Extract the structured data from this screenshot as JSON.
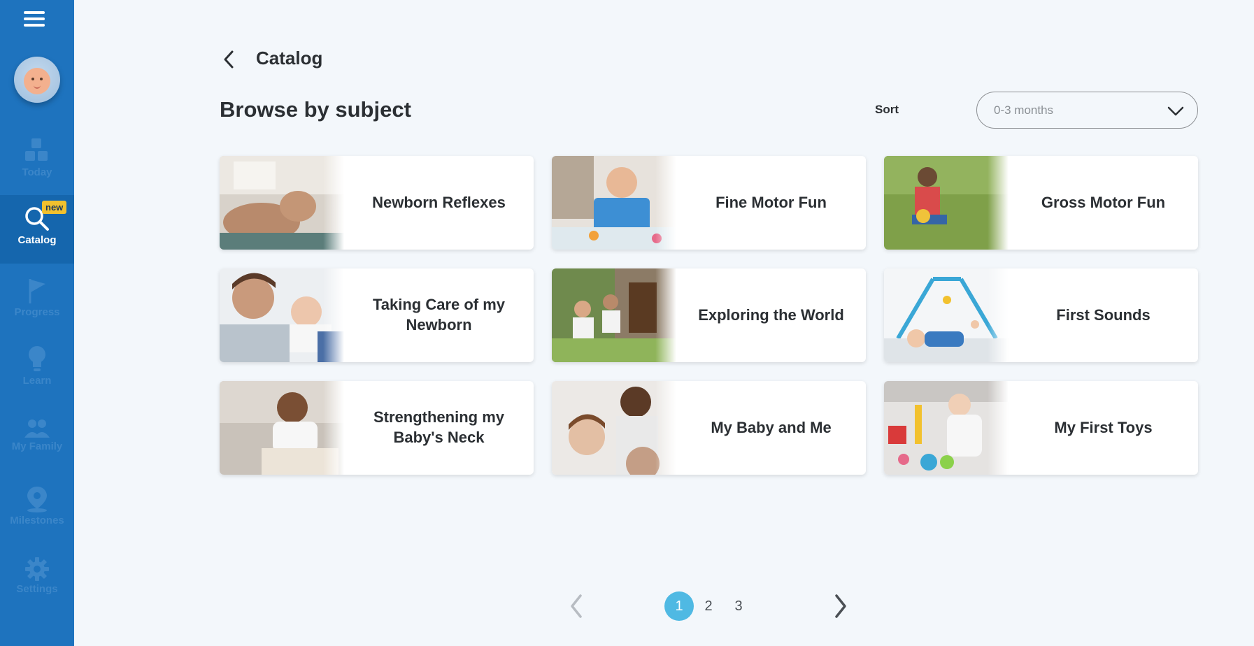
{
  "sidebar": {
    "items": [
      {
        "label": "Today",
        "icon": "blocks-icon"
      },
      {
        "label": "Catalog",
        "icon": "search-icon",
        "badge": "new"
      },
      {
        "label": "Progress",
        "icon": "flag-icon"
      },
      {
        "label": "Learn",
        "icon": "lightbulb-icon"
      },
      {
        "label": "My Family",
        "icon": "family-icon"
      },
      {
        "label": "Milestones",
        "icon": "location-pin-icon"
      },
      {
        "label": "Settings",
        "icon": "gear-icon"
      }
    ]
  },
  "header": {
    "breadcrumb": "Catalog",
    "title": "Browse by subject"
  },
  "sort": {
    "label": "Sort",
    "value": "0-3 months"
  },
  "cards": [
    {
      "title": "Newborn Reflexes"
    },
    {
      "title": "Fine Motor Fun"
    },
    {
      "title": "Gross Motor Fun"
    },
    {
      "title": "Taking Care of my Newborn"
    },
    {
      "title": "Exploring the World"
    },
    {
      "title": "First Sounds"
    },
    {
      "title": "Strengthening my Baby's Neck"
    },
    {
      "title": "My Baby and Me"
    },
    {
      "title": "My First Toys"
    }
  ],
  "pagination": {
    "pages": [
      "1",
      "2",
      "3"
    ],
    "current": "1"
  },
  "colors": {
    "sidebar": "#1e73be",
    "sidebar_active": "#1566ad",
    "badge": "#f2c12e",
    "page_active": "#4fb9e3",
    "background": "#f3f7fb"
  }
}
